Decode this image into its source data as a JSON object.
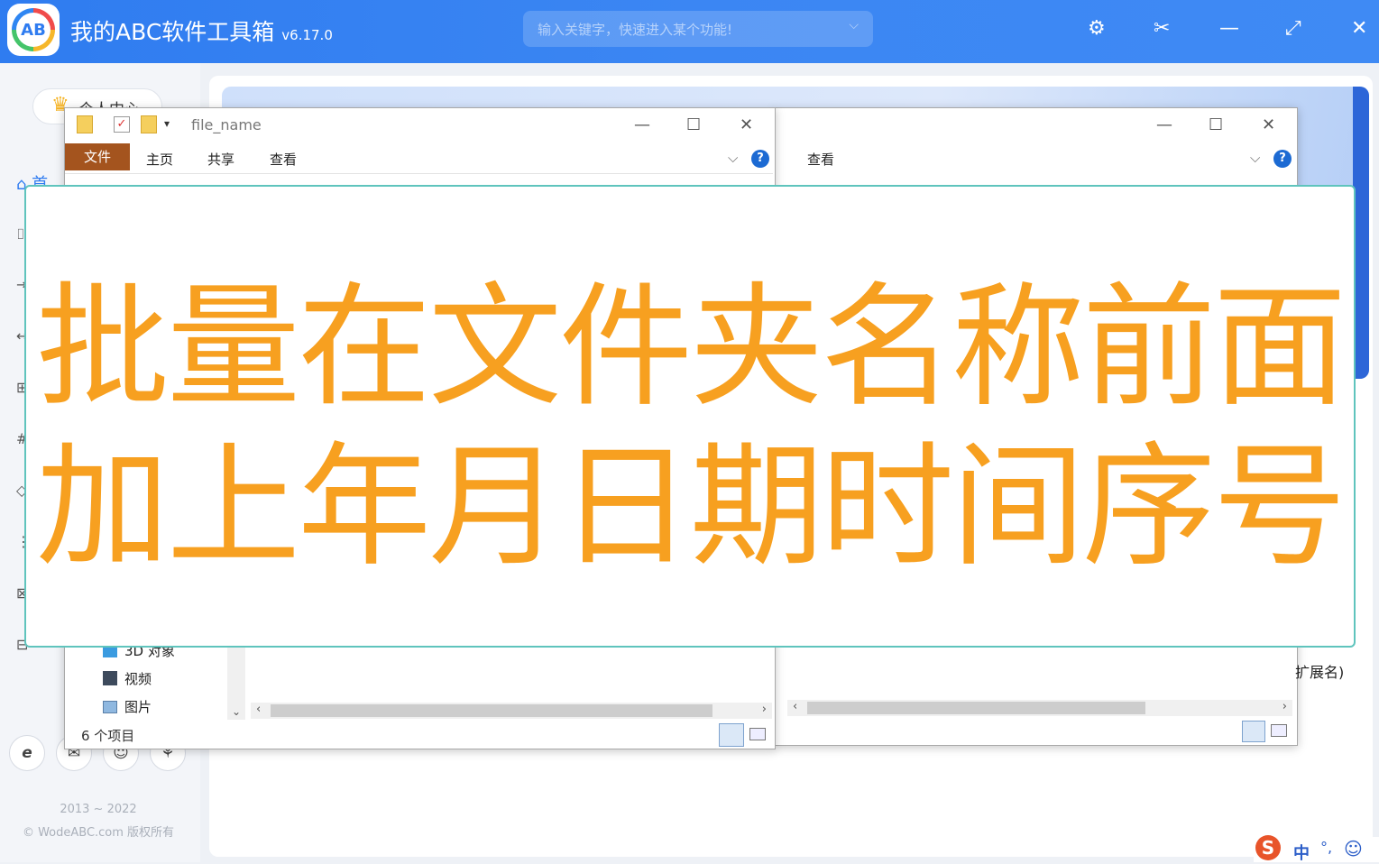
{
  "app": {
    "logo_text": "AB",
    "title": "我的ABC软件工具箱",
    "version": "v6.17.0",
    "search_placeholder": "输入关键字，快速进入某个功能!",
    "search_chevron": "⌵",
    "icons": {
      "settings": "⚙",
      "scissors": "✂",
      "minimize": "—",
      "maximize": "⤢",
      "close": "✕"
    }
  },
  "sidebar": {
    "personal_center": "个人中心",
    "crown_icon": "♛",
    "home_label": "首",
    "home_icon": "⌂",
    "side_icons": [
      "⌷",
      "⇥",
      "↔",
      "⊞",
      "#",
      "◇",
      "⋮",
      "⊠",
      "⊟"
    ],
    "bottom_icons": [
      "e",
      "✉",
      "☺",
      "⚘"
    ],
    "copyright_years": "2013 ~ 2022",
    "copyright_text": "© WodeABC.com 版权所有"
  },
  "explorer_left": {
    "title": "file_name",
    "tabs": [
      "文件",
      "主页",
      "共享",
      "查看"
    ],
    "ribbon_chevron": "⌵",
    "help": "?",
    "nav_items": [
      "3D 对象",
      "视频",
      "图片"
    ],
    "status": "6 个项目",
    "controls": {
      "minimize": "—",
      "maximize": "☐",
      "close": "✕"
    }
  },
  "explorer_right": {
    "tabs": [
      "查看"
    ],
    "ribbon_chevron": "⌵",
    "help": "?",
    "partial_text": "扩展名)",
    "controls": {
      "minimize": "—",
      "maximize": "☐",
      "close": "✕"
    }
  },
  "overlay": {
    "line1": "批量在文件夹名称前面",
    "line2": "加上年月日期时间序号"
  },
  "ime": {
    "logo": "S",
    "mode": "中",
    "punct": "°,",
    "emoji": "☺"
  },
  "colors": {
    "accent": "#2f7cf0",
    "overlay_text": "#f7a020",
    "overlay_border": "#5fc4bd",
    "file_tab": "#a4541e"
  }
}
